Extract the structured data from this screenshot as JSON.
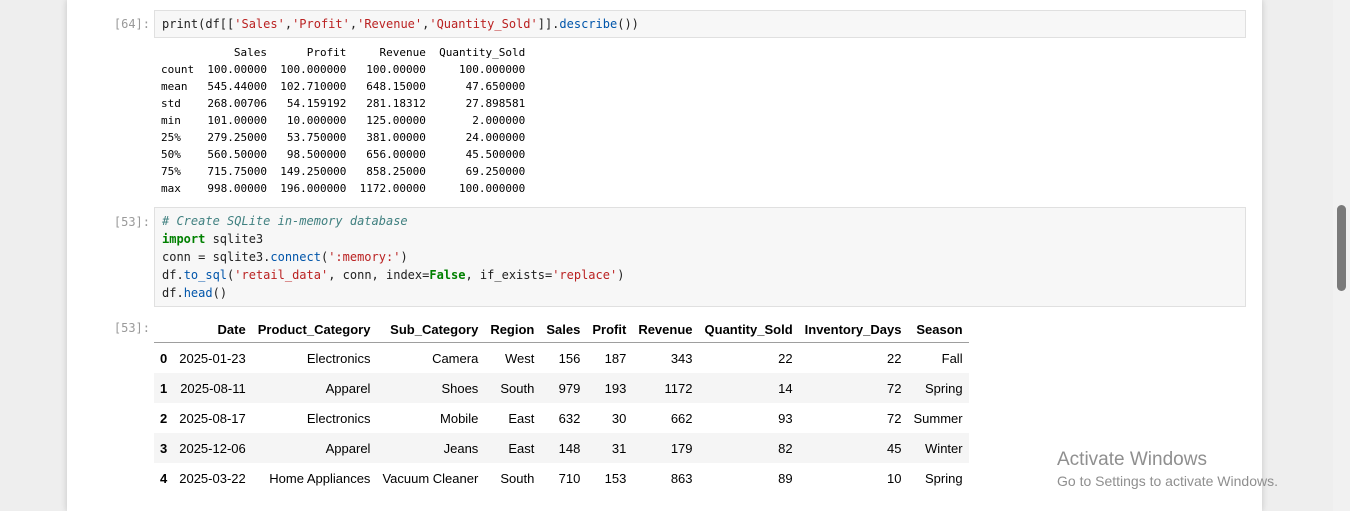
{
  "cells": [
    {
      "prompt": "[64]:",
      "code": "print(df[['Sales','Profit','Revenue','Quantity_Sold']].describe())",
      "output_lines": [
        "           Sales      Profit     Revenue  Quantity_Sold",
        "count  100.00000  100.000000   100.00000     100.000000",
        "mean   545.44000  102.710000   648.15000      47.650000",
        "std    268.00706   54.159192   281.18312      27.898581",
        "min    101.00000   10.000000   125.00000       2.000000",
        "25%    279.25000   53.750000   381.00000      24.000000",
        "50%    560.50000   98.500000   656.00000      45.500000",
        "75%    715.75000  149.250000   858.25000      69.250000",
        "max    998.00000  196.000000  1172.00000     100.000000"
      ]
    },
    {
      "prompt": "[53]:",
      "code_lines": [
        "# Create SQLite in-memory database",
        "import sqlite3",
        "conn = sqlite3.connect(':memory:')",
        "df.to_sql('retail_data', conn, index=False, if_exists='replace')",
        "df.head()"
      ],
      "output_prompt": "[53]:",
      "table": {
        "columns": [
          "",
          "Date",
          "Product_Category",
          "Sub_Category",
          "Region",
          "Sales",
          "Profit",
          "Revenue",
          "Quantity_Sold",
          "Inventory_Days",
          "Season"
        ],
        "rows": [
          [
            "0",
            "2025-01-23",
            "Electronics",
            "Camera",
            "West",
            "156",
            "187",
            "343",
            "22",
            "22",
            "Fall"
          ],
          [
            "1",
            "2025-08-11",
            "Apparel",
            "Shoes",
            "South",
            "979",
            "193",
            "1172",
            "14",
            "72",
            "Spring"
          ],
          [
            "2",
            "2025-08-17",
            "Electronics",
            "Mobile",
            "East",
            "632",
            "30",
            "662",
            "93",
            "72",
            "Summer"
          ],
          [
            "3",
            "2025-12-06",
            "Apparel",
            "Jeans",
            "East",
            "148",
            "31",
            "179",
            "82",
            "45",
            "Winter"
          ],
          [
            "4",
            "2025-03-22",
            "Home Appliances",
            "Vacuum Cleaner",
            "South",
            "710",
            "153",
            "863",
            "89",
            "10",
            "Spring"
          ]
        ]
      }
    }
  ],
  "code_tokens": {
    "c1": {
      "a": "print(df[[",
      "s1": "'Sales'",
      "c": ",",
      "s2": "'Profit'",
      "s3": "'Revenue'",
      "s4": "'Quantity_Sold'",
      "b": "]].",
      "m": "describe",
      "e": "())"
    },
    "c2": {
      "l1": "# Create SQLite in-memory database",
      "l2_kw": "import",
      "l2_rest": " sqlite3",
      "l3_a": "conn = sqlite3.",
      "l3_m": "connect",
      "l3_b": "(",
      "l3_s": "':memory:'",
      "l3_e": ")",
      "l4_a": "df.",
      "l4_m": "to_sql",
      "l4_b": "(",
      "l4_s1": "'retail_data'",
      "l4_c": ", conn, index=",
      "l4_kw": "False",
      "l4_d": ", if_exists=",
      "l4_s2": "'replace'",
      "l4_e": ")",
      "l5_a": "df.",
      "l5_m": "head",
      "l5_e": "()"
    }
  },
  "watermark": {
    "title": "Activate Windows",
    "subtitle": "Go to Settings to activate Windows."
  }
}
